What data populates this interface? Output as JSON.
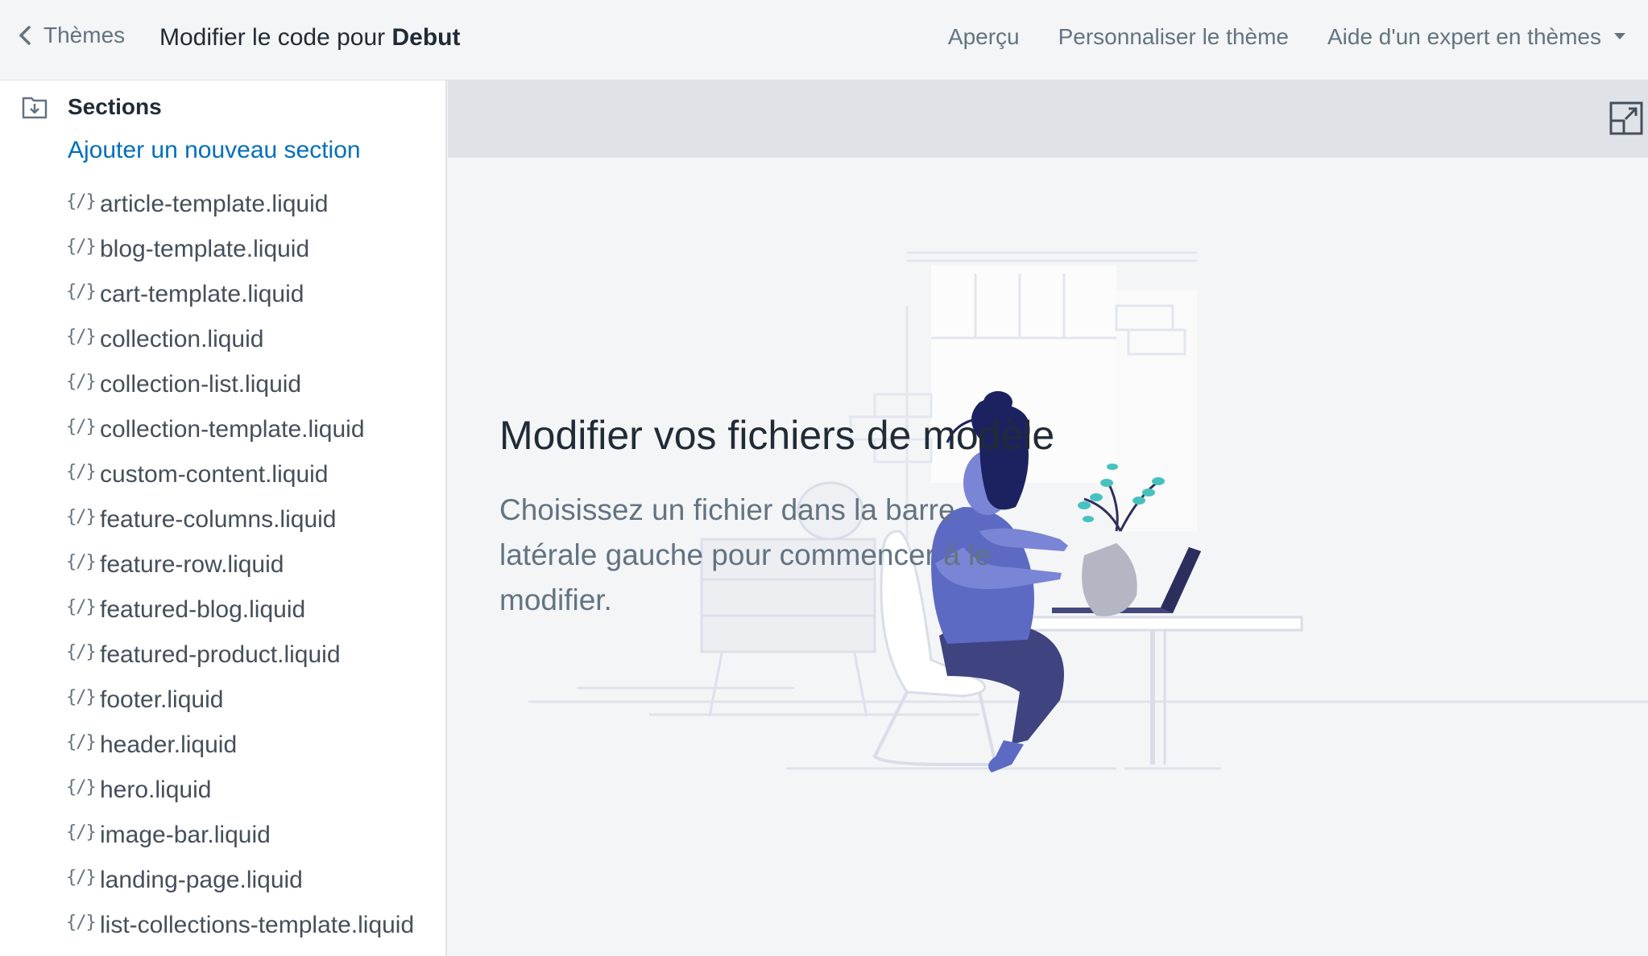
{
  "header": {
    "back_label": "Thèmes",
    "title_prefix": "Modifier le code pour",
    "theme_name": "Debut",
    "links": {
      "preview": "Aperçu",
      "customize": "Personnaliser le thème",
      "expert_help": "Aide d'un expert en thèmes"
    }
  },
  "sidebar": {
    "section_title": "Sections",
    "add_link": "Ajouter un nouveau section",
    "file_icon": "{/}",
    "files": [
      "article-template.liquid",
      "blog-template.liquid",
      "cart-template.liquid",
      "collection.liquid",
      "collection-list.liquid",
      "collection-template.liquid",
      "custom-content.liquid",
      "feature-columns.liquid",
      "feature-row.liquid",
      "featured-blog.liquid",
      "featured-product.liquid",
      "footer.liquid",
      "header.liquid",
      "hero.liquid",
      "image-bar.liquid",
      "landing-page.liquid",
      "list-collections-template.liquid"
    ]
  },
  "main": {
    "heading": "Modifier vos fichiers de modèle",
    "description": "Choisissez un fichier dans la barre latérale gauche pour commencer à le modifier."
  },
  "colors": {
    "link": "#006fbb",
    "illustration_primary": "#5c6ac4",
    "illustration_dark": "#1c2260"
  }
}
